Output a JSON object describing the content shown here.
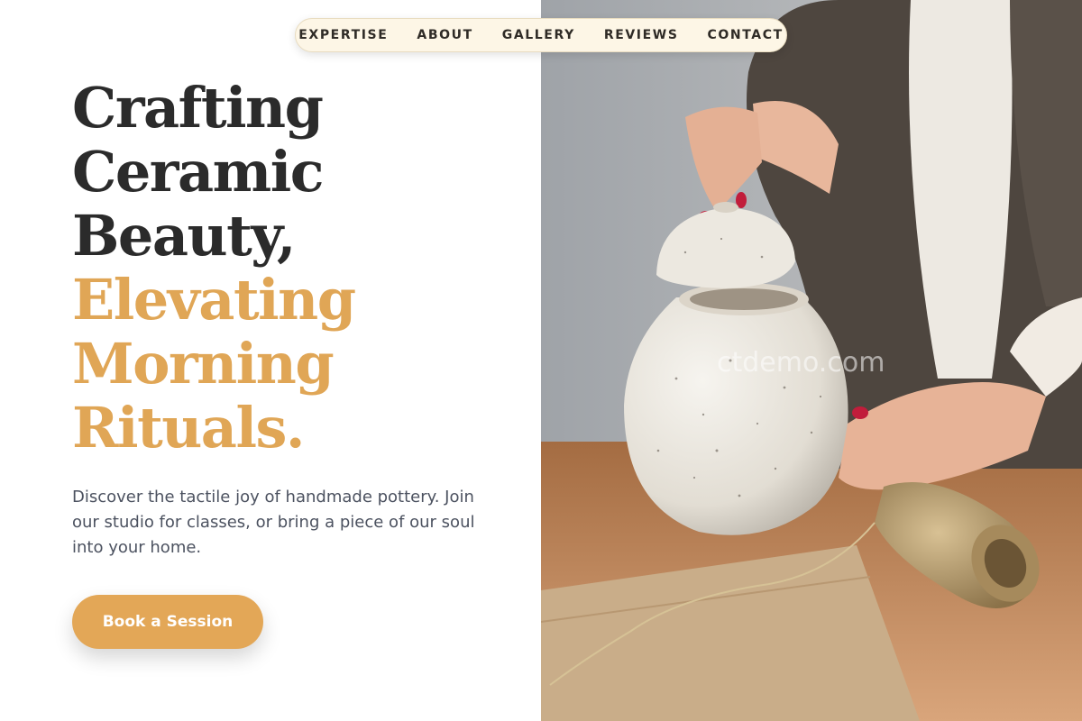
{
  "nav": {
    "items": [
      "EXPERTISE",
      "ABOUT",
      "GALLERY",
      "REVIEWS",
      "CONTACT"
    ]
  },
  "hero": {
    "title_dark": [
      "Crafting",
      "Ceramic",
      "Beauty,"
    ],
    "title_accent": [
      "Elevating",
      "Morning",
      "Rituals."
    ],
    "description": "Discover the tactile joy of handmade pottery. Join our studio for classes, or bring a piece of our soul into your home.",
    "cta_label": "Book a Session"
  },
  "photo": {
    "watermark": "ctdemo.com"
  },
  "colors": {
    "accent": "#e0a656",
    "heading": "#2b2b2b",
    "body_text": "#4c5260",
    "nav_background": "#fdf6e6"
  }
}
